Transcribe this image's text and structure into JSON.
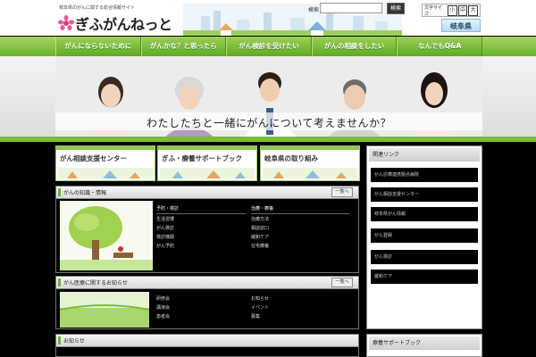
{
  "header": {
    "tagline": "岐阜県のがんに関する総合情報サイト",
    "logo_text": "ぎふがんねっと",
    "search_label": "検索",
    "search_placeholder": "",
    "search_button": "検索",
    "fontsize_label": "文字サイズ",
    "fontsize_options": [
      "小",
      "中",
      "大"
    ],
    "pref_label": "岐阜県"
  },
  "nav": {
    "items": [
      {
        "label": "がんにならないために"
      },
      {
        "label": "がんかな？と思ったら"
      },
      {
        "label": "がん検診を受けたい"
      },
      {
        "label": "がんの相談をしたい"
      },
      {
        "label": "なんでもQ&A"
      }
    ]
  },
  "hero": {
    "catch": "わたしたちと一緒にがんについて考えませんか？"
  },
  "banners": [
    {
      "label": "がん相談支援センター"
    },
    {
      "label": "ぎふ・療養サポートブック"
    },
    {
      "label": "岐阜県の取り組み"
    }
  ],
  "panels": {
    "p1": {
      "title": "がんの知識・情報",
      "more": "一覧へ"
    },
    "p2": {
      "title": "がん医療に関するお知らせ",
      "more": "一覧へ"
    },
    "p3": {
      "title": "お知らせ"
    }
  },
  "lists": {
    "l1": {
      "head": "予防・検診",
      "items": [
        "生活習慣",
        "がん検診",
        "検診機関",
        "がん予防"
      ]
    },
    "l2": {
      "head": "治療・療養",
      "items": [
        "治療方法",
        "相談窓口",
        "緩和ケア",
        "在宅療養"
      ]
    },
    "l3": {
      "items": [
        "研修会",
        "講演会",
        "患者会"
      ]
    },
    "l4": {
      "items": [
        "お知らせ",
        "イベント",
        "募集"
      ]
    }
  },
  "sidebar": {
    "box1_title": "関連リンク",
    "items": [
      "がん診療連携拠点病院",
      "がん相談支援センター",
      "岐阜県がん情報",
      "がん登録",
      "がん検診",
      "緩和ケア"
    ],
    "box2_title": "療養サポートブック"
  },
  "colors": {
    "accent": "#6cb32b",
    "nav": "#5faa20"
  }
}
